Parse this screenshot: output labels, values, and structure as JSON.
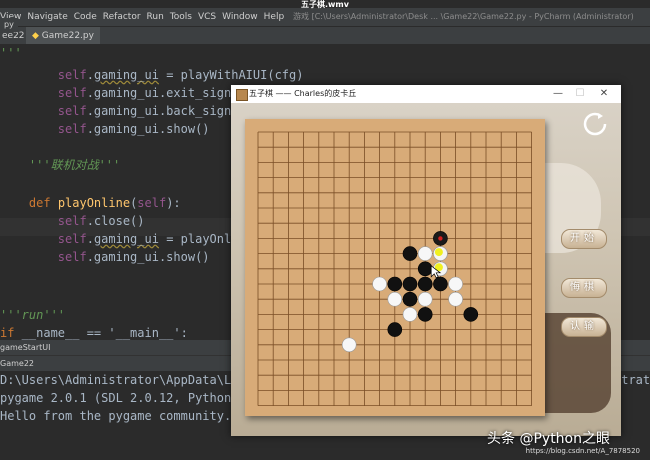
{
  "video_title": "五子棋.wmv",
  "ide": {
    "menu": [
      "View",
      "Navigate",
      "Code",
      "Refactor",
      "Run",
      "Tools",
      "VCS",
      "Window",
      "Help"
    ],
    "title_path": "游戏 [C:\\Users\\Administrator\\Desk ... \\Game22\\Game22.py - PyCharm (Administrator)",
    "left_tab": "ee22",
    "file_tab": "Game22.py",
    "left_tab2": "py"
  },
  "code_lines": [
    {
      "indent": "",
      "text": "'''"
    },
    {
      "indent": "        ",
      "parts": [
        [
          "slf",
          "self"
        ],
        [
          "",
          "."
        ],
        [
          "u",
          "gaming_ui"
        ],
        [
          "",
          " = playWithAIUI(cfg)"
        ]
      ]
    },
    {
      "indent": "        ",
      "parts": [
        [
          "slf",
          "self"
        ],
        [
          "",
          ".gaming_ui.exit_signa"
        ]
      ]
    },
    {
      "indent": "        ",
      "parts": [
        [
          "slf",
          "self"
        ],
        [
          "",
          ".gaming_ui.back_signa"
        ]
      ]
    },
    {
      "indent": "        ",
      "parts": [
        [
          "slf",
          "self"
        ],
        [
          "",
          ".gaming_ui.show()"
        ]
      ]
    },
    {
      "indent": "    ",
      "parts": [
        [
          "cmt",
          "'''联机对战'''"
        ]
      ]
    },
    {
      "indent": "",
      "parts": [
        [
          "",
          ""
        ]
      ]
    },
    {
      "indent": "    ",
      "parts": [
        [
          "kw",
          "def "
        ],
        [
          "fn",
          "playOnline"
        ],
        [
          "",
          "("
        ],
        [
          "slf",
          "self"
        ],
        [
          "",
          "):"
        ]
      ]
    },
    {
      "indent": "        ",
      "parts": [
        [
          "slf",
          "self"
        ],
        [
          "",
          ".close()"
        ]
      ]
    },
    {
      "indent": "        ",
      "parts": [
        [
          "slf",
          "self"
        ],
        [
          "",
          "."
        ],
        [
          "u",
          "gaming_ui"
        ],
        [
          "",
          " = playOnli"
        ]
      ]
    },
    {
      "indent": "        ",
      "parts": [
        [
          "slf",
          "self"
        ],
        [
          "",
          ".gaming_ui.show()"
        ]
      ]
    },
    {
      "indent": "",
      "parts": [
        [
          "",
          ""
        ]
      ]
    },
    {
      "indent": "",
      "parts": [
        [
          "",
          ""
        ]
      ]
    },
    {
      "indent": "",
      "parts": [
        [
          "cmt",
          "'''run'''"
        ]
      ]
    },
    {
      "indent": "",
      "parts": [
        [
          "kw",
          "if"
        ],
        [
          "",
          " __name__ == '__main__':"
        ]
      ]
    }
  ],
  "run_panel": {
    "header": "gameStartUI",
    "tab": "Game22",
    "console": [
      "D:\\Users\\Administrator\\AppData\\Lo",
      "pygame 2.0.1 (SDL 2.0.12, Python",
      "Hello from the pygame community.",
      "strat"
    ]
  },
  "game_window": {
    "title": "五子棋 —— Charles的皮卡丘",
    "min_glyph": "—",
    "max_glyph": "☐",
    "close_glyph": "✕",
    "buttons": {
      "start": "开始",
      "regret": "悔棋",
      "surrender": "认输"
    },
    "board": {
      "size": 19,
      "black_stones": [
        [
          10,
          8
        ],
        [
          11,
          9
        ],
        [
          9,
          10
        ],
        [
          10,
          10
        ],
        [
          11,
          10
        ],
        [
          12,
          10
        ],
        [
          10,
          11
        ],
        [
          11,
          12
        ],
        [
          14,
          12
        ],
        [
          9,
          13
        ]
      ],
      "white_stones": [
        [
          11,
          8
        ],
        [
          12,
          8
        ],
        [
          12,
          9
        ],
        [
          8,
          10
        ],
        [
          13,
          10
        ],
        [
          9,
          11
        ],
        [
          11,
          11
        ],
        [
          13,
          11
        ],
        [
          10,
          12
        ],
        [
          6,
          14
        ]
      ],
      "marked_stones": [
        [
          12,
          7,
          "black"
        ],
        [
          12,
          8,
          "yellow"
        ],
        [
          12,
          9,
          "yellow"
        ]
      ]
    }
  },
  "watermark": {
    "main": "头条 @Python之眼",
    "url": "https://blog.csdn.net/A_7878520"
  },
  "colors": {
    "board": "#d8ab78",
    "grid": "#7a4e26",
    "ide_bg": "#2b2b2b",
    "keyword": "#cc7832",
    "self": "#94558d"
  }
}
